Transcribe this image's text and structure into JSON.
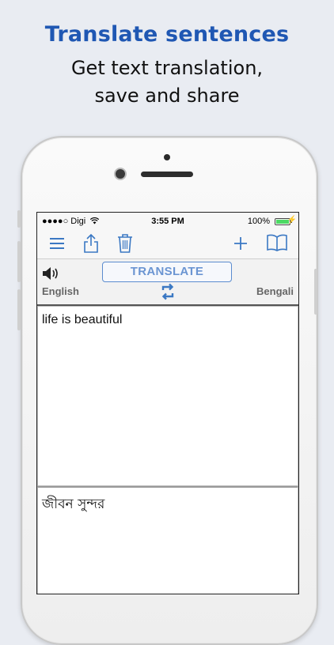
{
  "promo": {
    "headline": "Translate sentences",
    "subline1": "Get text translation,",
    "subline2": "save and share"
  },
  "status_bar": {
    "carrier": "●●●●○ Digi",
    "time": "3:55 PM",
    "battery": "100%"
  },
  "toolbar": {
    "icons": [
      "menu-icon",
      "share-icon",
      "trash-icon",
      "add-icon",
      "dictionary-icon"
    ]
  },
  "translator": {
    "translate_label": "TRANSLATE",
    "source_language": "English",
    "target_language": "Bengali",
    "input_text": "life is beautiful",
    "output_text": "জীবন সুন্দর"
  },
  "colors": {
    "headline": "#1f57b3",
    "accent": "#3b78c3",
    "battery": "#4cd964"
  }
}
